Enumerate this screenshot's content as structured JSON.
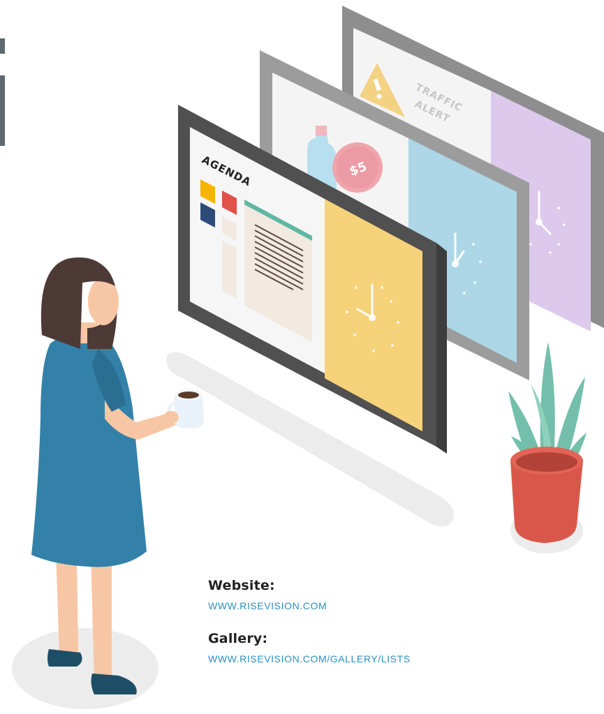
{
  "screens": {
    "back": {
      "title": "TRAFFIC ALERT",
      "title_line1": "TRAFFIC",
      "title_line2": "ALERT",
      "icon": "warning-icon"
    },
    "middle": {
      "price_badge": "$5"
    },
    "front": {
      "title": "AGENDA"
    }
  },
  "links": [
    {
      "label": "Website:",
      "url": "WWW.RISEVISION.COM"
    },
    {
      "label": "Gallery:",
      "url": "WWW.RISEVISION.COM/GALLERY/LISTS"
    }
  ],
  "colors": {
    "agenda_yellow": "#f6d27a",
    "middle_blue": "#add7e6",
    "back_lavender": "#dcc9ec",
    "dress_blue": "#3381a8",
    "pot_red": "#d9574a",
    "plant_green": "#73bfab",
    "link_blue": "#2c8fc2"
  }
}
